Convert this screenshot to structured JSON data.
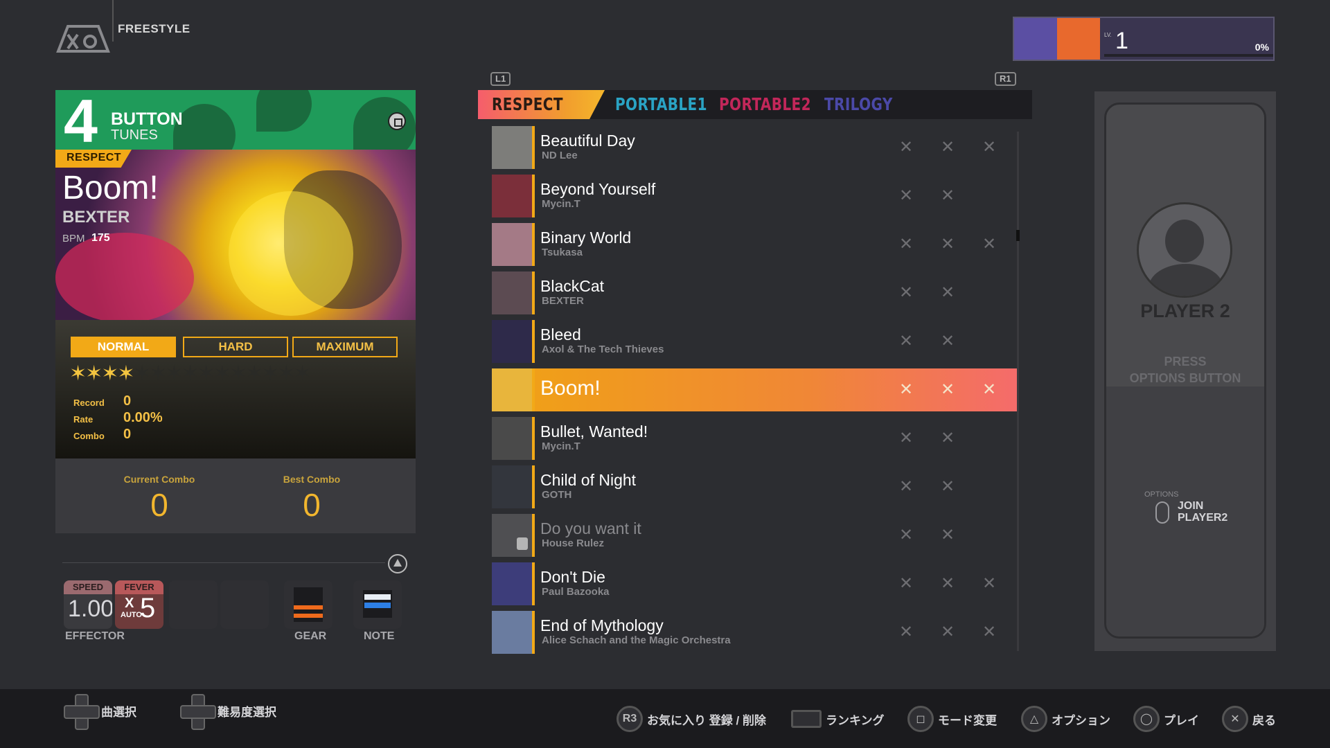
{
  "mode": {
    "label": "FREESTYLE"
  },
  "player_badge": {
    "lv_prefix": "LV.",
    "level": "1",
    "progress": "0%"
  },
  "song_panel": {
    "button_count": "4",
    "button_label": "BUTTON",
    "tunes_label": "TUNES",
    "category_tag": "RESPECT",
    "title": "Boom!",
    "artist": "BEXTER",
    "bpm_label": "BPM",
    "bpm_value": "175",
    "difficulties": [
      "NORMAL",
      "HARD",
      "MAXIMUM"
    ],
    "selected_difficulty": "NORMAL",
    "stars_filled": 4,
    "stars_total": 15,
    "record_label": "Record",
    "record_value": "0",
    "rate_label": "Rate",
    "rate_value": "0.00%",
    "combo_label": "Combo",
    "combo_value": "0",
    "current_combo_label": "Current Combo",
    "current_combo_value": "0",
    "best_combo_label": "Best Combo",
    "best_combo_value": "0"
  },
  "effector": {
    "speed_label": "SPEED",
    "speed_value": "1.00",
    "fever_label": "FEVER",
    "fever_x": "X",
    "fever_value": "5",
    "fever_auto": "AUTO",
    "effector_label": "EFFECTOR",
    "gear_label": "GEAR",
    "note_label": "NOTE"
  },
  "tabs": {
    "left_key": "L1",
    "right_key": "R1",
    "items": [
      {
        "label": "RESPECT",
        "color": "#2a1c14"
      },
      {
        "label": "PORTABLE1",
        "color": "#2aa3c4"
      },
      {
        "label": "PORTABLE2",
        "color": "#c2275a"
      },
      {
        "label": "TRILOGY",
        "color": "#4b49a8"
      }
    ]
  },
  "songs": [
    {
      "title": "Beautiful Day",
      "artist": "ND Lee",
      "marks": 3,
      "thumb": "#7d7d7a"
    },
    {
      "title": "Beyond Yourself",
      "artist": "Mycin.T",
      "marks": 2,
      "thumb": "#7b2f3a"
    },
    {
      "title": "Binary World",
      "artist": "Tsukasa",
      "marks": 3,
      "thumb": "#a47a86"
    },
    {
      "title": "BlackCat",
      "artist": "BEXTER",
      "marks": 2,
      "thumb": "#5c4b52"
    },
    {
      "title": "Bleed",
      "artist": "Axol & The Tech Thieves",
      "marks": 2,
      "thumb": "#2e2a4a"
    },
    {
      "title": "Boom!",
      "artist": "",
      "marks": 3,
      "thumb": "#e8b53c",
      "selected": true
    },
    {
      "title": "Bullet, Wanted!",
      "artist": "Mycin.T",
      "marks": 2,
      "thumb": "#4a4a4a"
    },
    {
      "title": "Child of Night",
      "artist": "GOTH",
      "marks": 2,
      "thumb": "#33363d"
    },
    {
      "title": "Do you want it",
      "artist": "House Rulez",
      "marks": 2,
      "thumb": "#4f4f52",
      "locked": true
    },
    {
      "title": "Don't Die",
      "artist": "Paul Bazooka",
      "marks": 3,
      "thumb": "#3d3d7a"
    },
    {
      "title": "End of Mythology",
      "artist": "Alice Schach and the Magic Orchestra",
      "marks": 3,
      "thumb": "#6a7ca0"
    }
  ],
  "player2": {
    "name": "PLAYER 2",
    "press_line1": "PRESS",
    "press_line2": "OPTIONS BUTTON",
    "options_label": "OPTIONS",
    "join_line1": "JOIN",
    "join_line2": "PLAYER2"
  },
  "hints": {
    "song_select": "曲選択",
    "difficulty_select": "難易度選択",
    "r3_key": "R3",
    "favorite": "お気に入り 登録 / 削除",
    "ranking": "ランキング",
    "mode_change": "モード変更",
    "option": "オプション",
    "play": "プレイ",
    "back": "戻る"
  }
}
